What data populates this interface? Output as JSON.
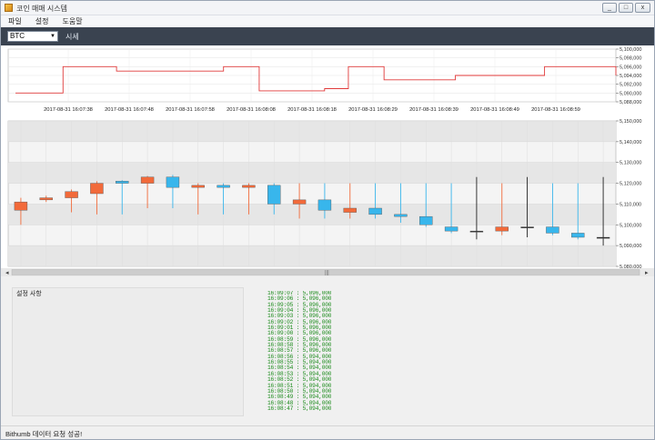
{
  "window": {
    "title": "코인 매매 시스템",
    "controls": [
      "_",
      "□",
      "x"
    ]
  },
  "menu": [
    "파일",
    "설정",
    "도움말"
  ],
  "toolbar": {
    "coin_selected": "BTC",
    "price_label": "시세"
  },
  "chart_data": [
    {
      "type": "line",
      "ylim": [
        5088000,
        5100000
      ],
      "y_ticks": [
        "5,100,000",
        "5,098,000",
        "5,096,000",
        "5,094,000",
        "5,092,000",
        "5,090,000",
        "5,088,000"
      ],
      "y_tick_values": [
        5100000,
        5098000,
        5096000,
        5094000,
        5092000,
        5090000,
        5088000
      ],
      "x_tick_labels": [
        "2017-08-31 16:07:38",
        "2017-08-31 16:07:48",
        "2017-08-31 16:07:58",
        "2017-08-31 16:08:08",
        "2017-08-31 16:08:18",
        "2017-08-31 16:08:29",
        "2017-08-31 16:08:39",
        "2017-08-31 16:08:49",
        "2017-08-31 16:08:59"
      ],
      "series": [
        {
          "values": [
            5090000,
            5090000,
            5090000,
            5090000,
            5090000,
            5090000,
            5090000,
            5090000,
            5096000,
            5096000,
            5096000,
            5096000,
            5096000,
            5096000,
            5096000,
            5096000,
            5096000,
            5095000,
            5095000,
            5095000,
            5095000,
            5095000,
            5095000,
            5095000,
            5095000,
            5095000,
            5095000,
            5095000,
            5095000,
            5095000,
            5095000,
            5095000,
            5095000,
            5095000,
            5095000,
            5096000,
            5096000,
            5096000,
            5096000,
            5096000,
            5096000,
            5090500,
            5090500,
            5090500,
            5090500,
            5090500,
            5090500,
            5090500,
            5090500,
            5090500,
            5090500,
            5090500,
            5091000,
            5091000,
            5091000,
            5091000,
            5096000,
            5096000,
            5096000,
            5096000,
            5096000,
            5096000,
            5093000,
            5093000,
            5093000,
            5093000,
            5093000,
            5093000,
            5093000,
            5093000,
            5093000,
            5093000,
            5093000,
            5093000,
            5094000,
            5094000,
            5094000,
            5094000,
            5094000,
            5094000,
            5094000,
            5094000,
            5094000,
            5094000,
            5094000,
            5094000,
            5094000,
            5094000,
            5094000,
            5096000,
            5096000,
            5096000,
            5096000,
            5096000,
            5096000,
            5096000,
            5096000,
            5096000,
            5096000,
            5096000,
            5096000,
            5094000
          ],
          "color": "#e03a3a"
        }
      ]
    },
    {
      "type": "candlestick",
      "ylim": [
        5080000,
        5150000
      ],
      "y_ticks": [
        "5,150,000",
        "5,140,000",
        "5,130,000",
        "5,120,000",
        "5,110,000",
        "5,100,000",
        "5,090,000",
        "5,080,000"
      ],
      "y_tick_values": [
        5150000,
        5140000,
        5130000,
        5120000,
        5110000,
        5100000,
        5090000,
        5080000
      ],
      "candles": [
        {
          "open": 5107000,
          "close": 5111000,
          "high": 5113000,
          "low": 5100000,
          "dir": "up"
        },
        {
          "open": 5112000,
          "close": 5113000,
          "high": 5114000,
          "low": 5111000,
          "dir": "up"
        },
        {
          "open": 5113000,
          "close": 5116000,
          "high": 5117000,
          "low": 5106000,
          "dir": "up"
        },
        {
          "open": 5115000,
          "close": 5120000,
          "high": 5121000,
          "low": 5105000,
          "dir": "up"
        },
        {
          "open": 5121000,
          "close": 5120000,
          "high": 5121500,
          "low": 5105000,
          "dir": "down"
        },
        {
          "open": 5120000,
          "close": 5123000,
          "high": 5123500,
          "low": 5108000,
          "dir": "up"
        },
        {
          "open": 5123000,
          "close": 5118000,
          "high": 5124000,
          "low": 5108000,
          "dir": "down"
        },
        {
          "open": 5118000,
          "close": 5119000,
          "high": 5120000,
          "low": 5105000,
          "dir": "up"
        },
        {
          "open": 5119000,
          "close": 5118000,
          "high": 5120000,
          "low": 5105000,
          "dir": "down"
        },
        {
          "open": 5118000,
          "close": 5119000,
          "high": 5120000,
          "low": 5105000,
          "dir": "up"
        },
        {
          "open": 5119000,
          "close": 5110000,
          "high": 5120000,
          "low": 5105000,
          "dir": "down"
        },
        {
          "open": 5110000,
          "close": 5112000,
          "high": 5120000,
          "low": 5103000,
          "dir": "up"
        },
        {
          "open": 5112000,
          "close": 5107000,
          "high": 5120000,
          "low": 5103000,
          "dir": "down"
        },
        {
          "open": 5106000,
          "close": 5108000,
          "high": 5120000,
          "low": 5103000,
          "dir": "up"
        },
        {
          "open": 5108000,
          "close": 5105000,
          "high": 5120000,
          "low": 5103000,
          "dir": "down"
        },
        {
          "open": 5105000,
          "close": 5104000,
          "high": 5120000,
          "low": 5101000,
          "dir": "down"
        },
        {
          "open": 5104000,
          "close": 5100000,
          "high": 5120000,
          "low": 5099000,
          "dir": "down"
        },
        {
          "open": 5099000,
          "close": 5097000,
          "high": 5120000,
          "low": 5096000,
          "dir": "down"
        },
        {
          "open": 5097000,
          "close": 5097000,
          "high": 5123000,
          "low": 5093000,
          "dir": "flat"
        },
        {
          "open": 5097000,
          "close": 5099000,
          "high": 5120000,
          "low": 5095000,
          "dir": "up"
        },
        {
          "open": 5099000,
          "close": 5099000,
          "high": 5123000,
          "low": 5094000,
          "dir": "flat"
        },
        {
          "open": 5099000,
          "close": 5096000,
          "high": 5120000,
          "low": 5095000,
          "dir": "down"
        },
        {
          "open": 5096000,
          "close": 5094000,
          "high": 5120000,
          "low": 5093000,
          "dir": "down"
        },
        {
          "open": 5094000,
          "close": 5094000,
          "high": 5123000,
          "low": 5090000,
          "dir": "flat"
        }
      ],
      "colors": {
        "up": "#f26a3a",
        "down": "#38b6ec",
        "flat": "#222222"
      }
    }
  ],
  "settings": {
    "title": "설정 사항"
  },
  "ticker": [
    "16:09:07 : 5,096,000",
    "16:09:06 : 5,096,000",
    "16:09:05 : 5,096,000",
    "16:09:04 : 5,096,000",
    "16:09:03 : 5,096,000",
    "16:09:02 : 5,096,000",
    "16:09:01 : 5,096,000",
    "16:09:00 : 5,096,000",
    "16:08:59 : 5,096,000",
    "16:08:58 : 5,096,000",
    "16:08:57 : 5,096,000",
    "16:08:56 : 5,094,000",
    "16:08:55 : 5,094,000",
    "16:08:54 : 5,094,000",
    "16:08:53 : 5,094,000",
    "16:08:52 : 5,094,000",
    "16:08:51 : 5,094,000",
    "16:08:50 : 5,094,000",
    "16:08:49 : 5,094,000",
    "16:08:48 : 5,094,000",
    "16:08:47 : 5,094,000"
  ],
  "status": {
    "text": "Bithumb 데이터 요청 성공!"
  },
  "scrollbar": {
    "left_arrow": "◂",
    "right_arrow": "▸",
    "thumb": "|||"
  }
}
